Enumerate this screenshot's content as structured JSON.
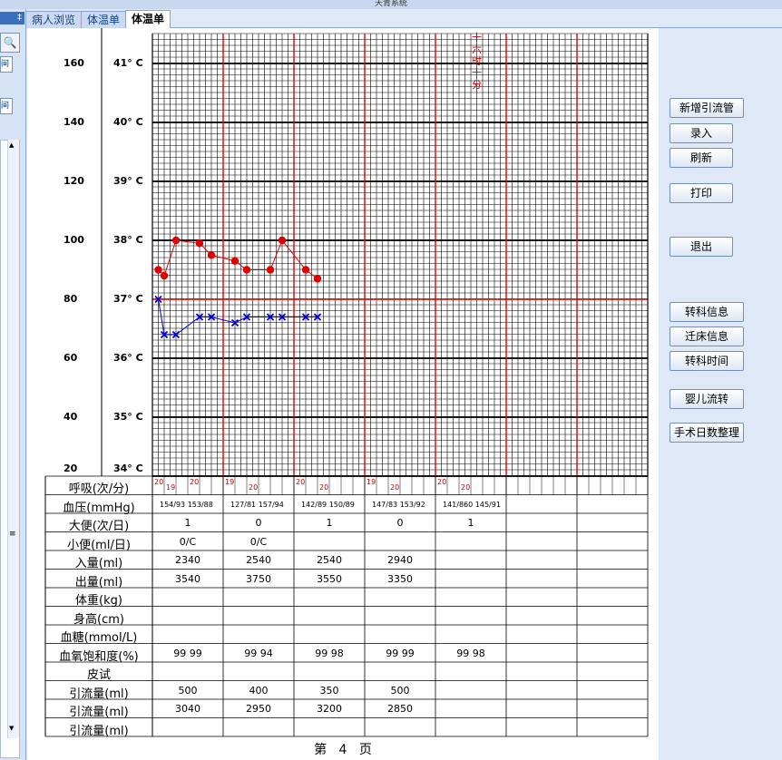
{
  "window_title": "天青系统",
  "left_panel": {
    "pin_glyph": "‡",
    "search_icon": "search-icon",
    "btn1": "间",
    "btn2": "间",
    "scroll_up": "▲",
    "scroll_down": "▼",
    "grip": "≡"
  },
  "tabs": [
    {
      "label": "病人浏览"
    },
    {
      "label": "体温单"
    },
    {
      "label": "体温单"
    }
  ],
  "scale": {
    "pulse_labels": [
      "160",
      "140",
      "120",
      "100",
      "80",
      "60",
      "40",
      "20"
    ],
    "temp_labels": [
      "41° C",
      "40° C",
      "39° C",
      "38° C",
      "37° C",
      "36° C",
      "35° C",
      "34° C"
    ]
  },
  "annotation": "十六时十分",
  "chart_data": {
    "type": "line",
    "temperature_series": {
      "name": "体温",
      "color": "#e00000",
      "points": [
        {
          "slot": 0,
          "t": 37.5
        },
        {
          "slot": 1,
          "t": 37.4
        },
        {
          "slot": 3,
          "t": 38.0
        },
        {
          "slot": 7,
          "t": 37.95
        },
        {
          "slot": 9,
          "t": 37.75
        },
        {
          "slot": 13,
          "t": 37.65
        },
        {
          "slot": 15,
          "t": 37.5
        },
        {
          "slot": 19,
          "t": 37.5
        },
        {
          "slot": 21,
          "t": 38.0
        },
        {
          "slot": 25,
          "t": 37.5
        },
        {
          "slot": 27,
          "t": 37.35
        }
      ]
    },
    "pulse_series": {
      "name": "脉搏",
      "color": "#0000d0",
      "points": [
        {
          "slot": 0,
          "p": 80
        },
        {
          "slot": 1,
          "p": 68
        },
        {
          "slot": 3,
          "p": 68
        },
        {
          "slot": 7,
          "p": 74
        },
        {
          "slot": 9,
          "p": 74
        },
        {
          "slot": 13,
          "p": 72
        },
        {
          "slot": 15,
          "p": 74
        },
        {
          "slot": 19,
          "p": 74
        },
        {
          "slot": 21,
          "p": 74
        },
        {
          "slot": 25,
          "p": 74
        },
        {
          "slot": 27,
          "p": 74
        }
      ]
    },
    "temp_range": [
      34,
      41.5
    ],
    "pulse_range": [
      20,
      170
    ]
  },
  "table": {
    "rows": [
      {
        "label": "呼吸(次/分)",
        "type": "resp",
        "values": [
          [
            "20",
            "19",
            "20"
          ],
          [
            "19",
            "20"
          ],
          [
            "20",
            "20"
          ],
          [
            "19",
            "20"
          ],
          [
            "20",
            "20"
          ],
          [],
          [],
          []
        ]
      },
      {
        "label": "血压(mmHg)",
        "type": "bp",
        "values": [
          "154/93 153/88",
          "127/81 157/94",
          "142/89 150/89",
          "147/83 153/92",
          "141/860 145/91",
          "",
          "",
          ""
        ]
      },
      {
        "label": "大便(次/日)",
        "values": [
          "1",
          "0",
          "1",
          "0",
          "1",
          "",
          "",
          ""
        ]
      },
      {
        "label": "小便(ml/日)",
        "values": [
          "0/C",
          "0/C",
          "",
          "",
          "",
          "",
          "",
          ""
        ]
      },
      {
        "label": "入量(ml)",
        "values": [
          "2340",
          "2540",
          "2540",
          "2940",
          "",
          "",
          "",
          ""
        ]
      },
      {
        "label": "出量(ml)",
        "values": [
          "3540",
          "3750",
          "3550",
          "3350",
          "",
          "",
          "",
          ""
        ]
      },
      {
        "label": "体重(kg)",
        "values": [
          "",
          "",
          "",
          "",
          "",
          "",
          "",
          ""
        ]
      },
      {
        "label": "身高(cm)",
        "values": [
          "",
          "",
          "",
          "",
          "",
          "",
          "",
          ""
        ]
      },
      {
        "label": "血糖(mmol/L)",
        "values": [
          "",
          "",
          "",
          "",
          "",
          "",
          "",
          ""
        ]
      },
      {
        "label": "血氧饱和度(%)",
        "values": [
          "99 99",
          "99 94",
          "99 98",
          "99 99",
          "99 98",
          "",
          "",
          ""
        ]
      },
      {
        "label": "皮试",
        "values": [
          "",
          "",
          "",
          "",
          "",
          "",
          "",
          ""
        ]
      },
      {
        "label": "引流量(ml)",
        "values": [
          "500",
          "400",
          "350",
          "500",
          "",
          "",
          "",
          ""
        ]
      },
      {
        "label": "引流量(ml)",
        "values": [
          "3040",
          "2950",
          "3200",
          "2850",
          "",
          "",
          "",
          ""
        ]
      },
      {
        "label": "引流量(ml)",
        "values": [
          "",
          "",
          "",
          "",
          "",
          "",
          "",
          ""
        ]
      }
    ]
  },
  "footer": {
    "page_prefix": "第",
    "page_number": "4",
    "page_suffix": "页"
  },
  "right_buttons": [
    {
      "label": "新增引流管"
    },
    {
      "label": "录入"
    },
    {
      "label": "刷新"
    },
    {
      "label": "打印"
    },
    {
      "label": "退出"
    },
    {
      "label": "转科信息"
    },
    {
      "label": "迁床信息"
    },
    {
      "label": "转科时间"
    },
    {
      "label": "婴儿流转"
    },
    {
      "label": "手术日数整理"
    }
  ]
}
